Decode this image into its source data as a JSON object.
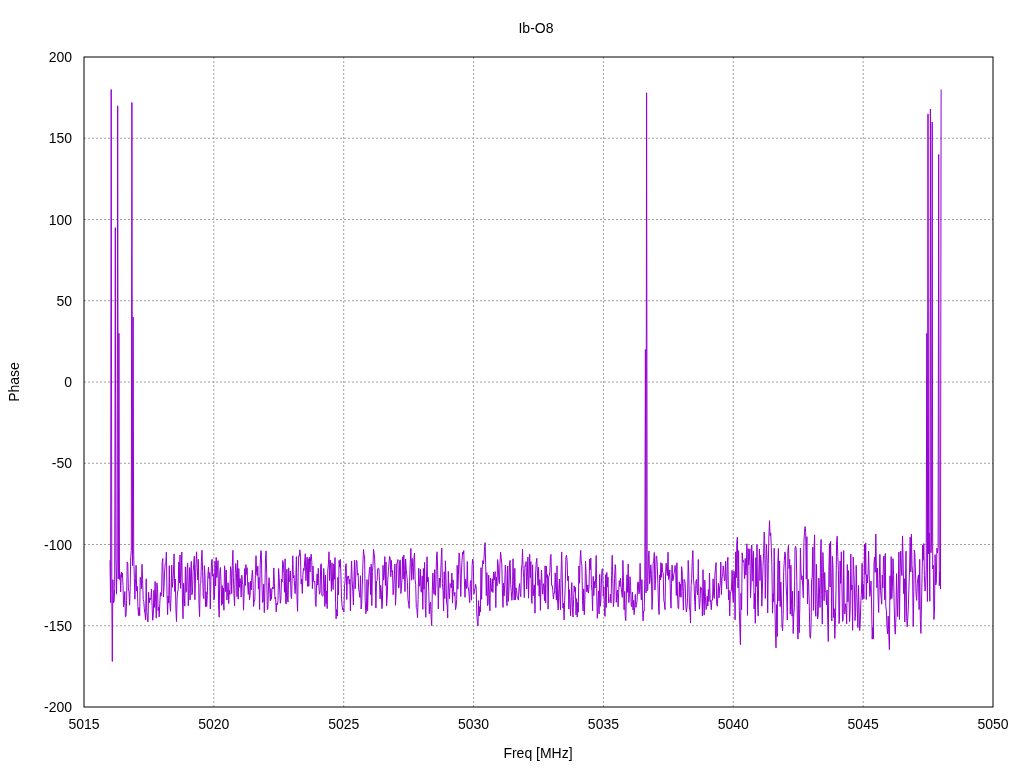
{
  "chart": {
    "title": "Ib-O8",
    "xlabel": "Freq [MHz]",
    "ylabel": "Phase",
    "xticks": [
      "5015",
      "5020",
      "5025",
      "5030",
      "5035",
      "5040",
      "5045",
      "5050"
    ],
    "yticks": [
      "200",
      "150",
      "100",
      "50",
      "0",
      "-50",
      "-100",
      "-150",
      "-200"
    ]
  }
}
